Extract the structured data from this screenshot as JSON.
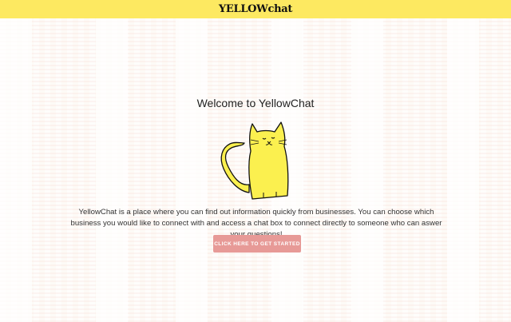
{
  "header": {
    "brand": "YELLOWchat",
    "background_color": "#fde961"
  },
  "main": {
    "welcome_title": "Welcome to YellowChat",
    "mascot_icon": "yellow-cat-illustration",
    "description": "YellowChat is a place where you can find out information quickly from businesses. You can choose which business you would like to connect with and access a chat box to connect directly to someone who can aswer your questions!",
    "cta_label": "CLICK HERE TO GET STARTED",
    "cta_color": "#e79a97",
    "cat_color": "#fbf04f"
  }
}
